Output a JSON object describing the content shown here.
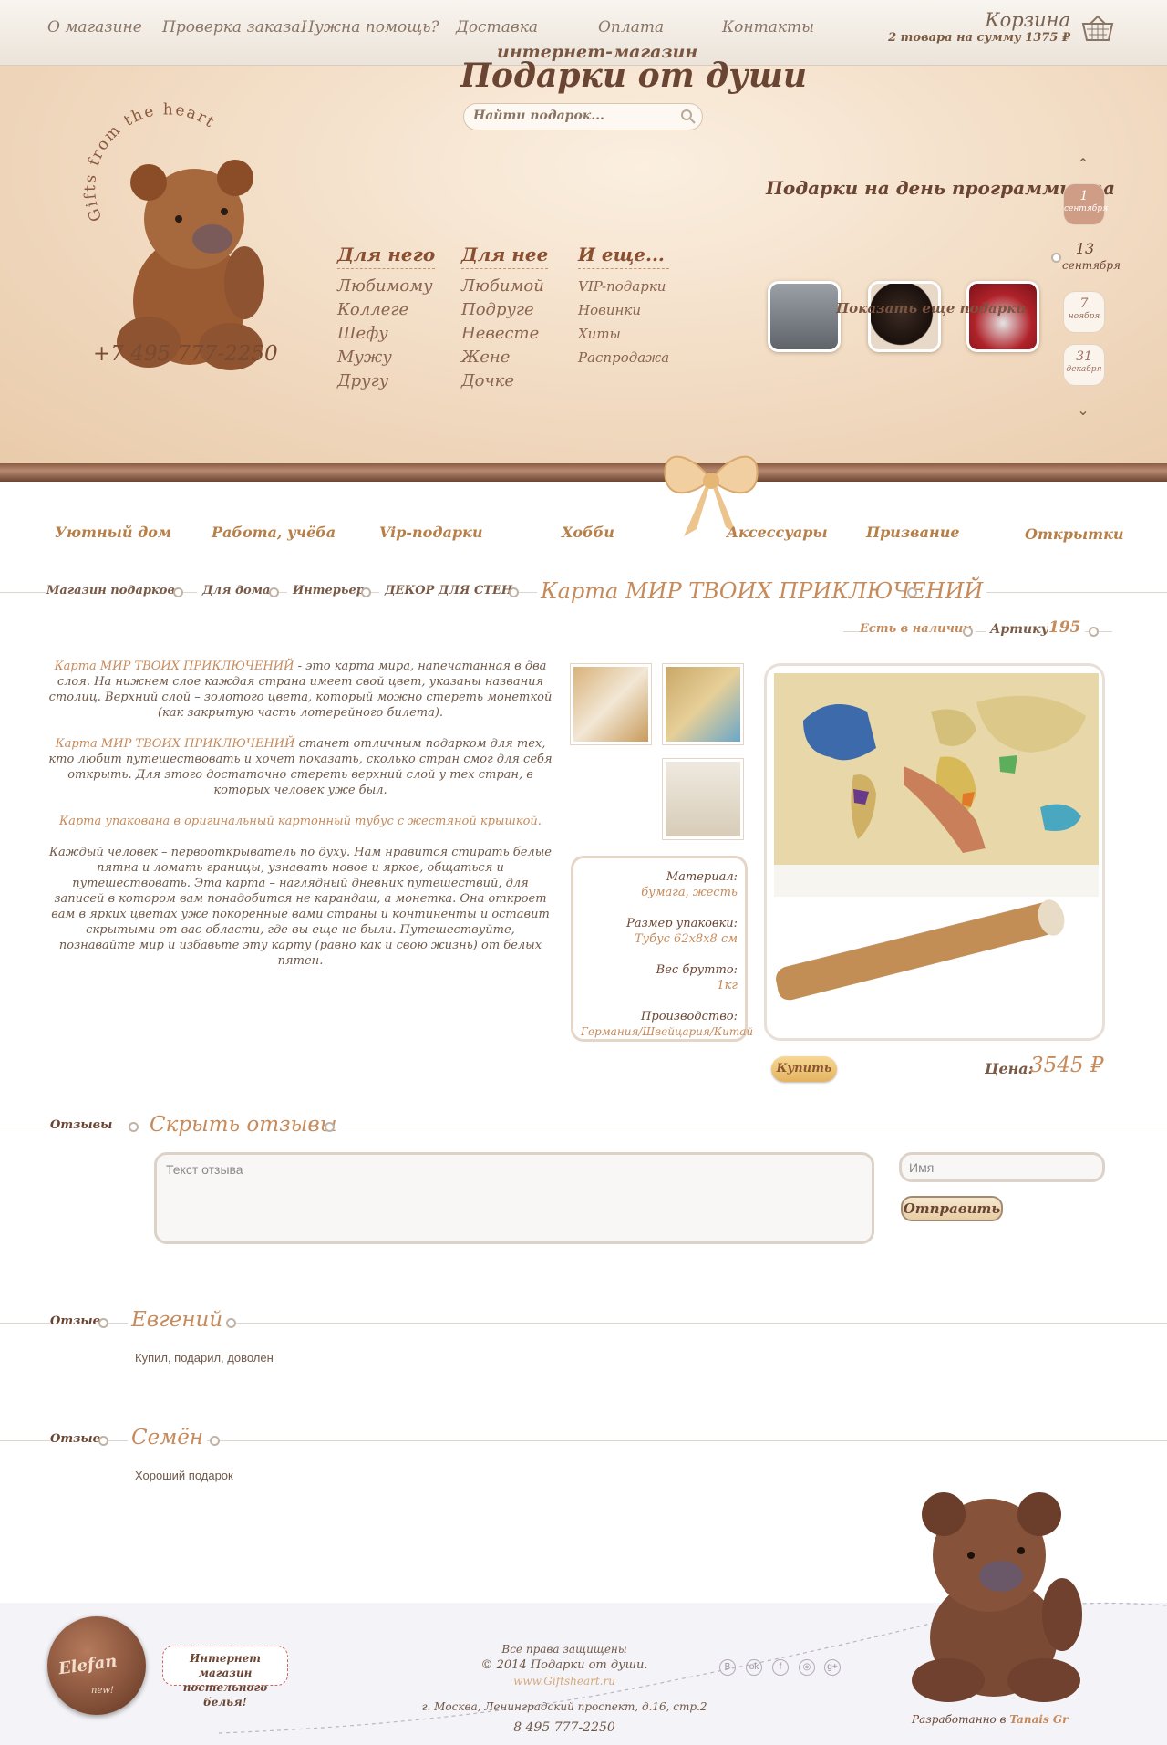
{
  "nav": {
    "items": [
      "О магазине",
      "Проверка заказа",
      "Нужна помощь?",
      "Доставка",
      "Оплата",
      "Контакты"
    ],
    "cart_title": "Корзина",
    "cart_summary": "2 товара на сумму 1375 ₽"
  },
  "header": {
    "slogan": "Gifts from the heart",
    "phone": "+7 495 777-2250",
    "shop_subtitle": "интернет-магазин",
    "shop_title": "Подарки от души",
    "search_placeholder": "Найти подарок...",
    "columns": [
      {
        "title": "Для него",
        "items": [
          "Любимому",
          "Коллеге",
          "Шефу",
          "Мужу",
          "Другу"
        ]
      },
      {
        "title": "Для нее",
        "items": [
          "Любимой",
          "Подруге",
          "Невесте",
          "Жене",
          "Дочке"
        ]
      },
      {
        "title": "И еще...",
        "items": [
          "VIP-подарки",
          "Новинки",
          "Хиты",
          "Распродажа"
        ]
      }
    ],
    "gifts_title": "Подарки на день программиста",
    "more_gifts": "Показать еще подарки",
    "dates": [
      {
        "day": "1",
        "month": "сентября"
      },
      {
        "day": "13",
        "month": "сентября"
      },
      {
        "day": "7",
        "month": "ноября"
      },
      {
        "day": "31",
        "month": "декабря"
      }
    ]
  },
  "categories": [
    "Уютный дом",
    "Работа, учёба",
    "Vip-подарки",
    "Хобби",
    "Аксессуары",
    "Призвание",
    "Открытки"
  ],
  "breadcrumb": [
    "Магазин подарков",
    "Для дома",
    "Интерьер",
    "ДЕКОР ДЛЯ СТЕН"
  ],
  "product": {
    "title": "Карта МИР ТВОИХ ПРИКЛЮЧЕНИЙ",
    "availability": "Есть в наличии",
    "article_label": "Артикул:",
    "article_value": "195",
    "desc1_hl": "Карта МИР ТВОИХ ПРИКЛЮЧЕНИЙ",
    "desc1": " - это карта мира, напечатанная в два слоя. На нижнем слое каждая страна имеет свой цвет, указаны названия столиц. Верхний слой – золотого цвета, который можно стереть монеткой (как закрытую часть лотерейного билета).",
    "desc2_hl": "Карта МИР ТВОИХ ПРИКЛЮЧЕНИЙ",
    "desc2": " станет отличным подарком для тех, кто любит путешествовать и хочет показать, сколько стран смог для себя открыть. Для этого достаточно стереть верхний слой у тех стран, в которых человек уже был.",
    "desc3": "Карта упакована в оригинальный картонный тубус с жестяной крышкой.",
    "desc4": "Каждый человек – первооткрыватель по духу. Нам нравится стирать белые пятна и ломать границы, узнавать новое и яркое, общаться и путешествовать. Эта карта – наглядный дневник путешествий, для записей в котором вам понадобится не карандаш, а монетка. Она откроет вам в ярких цветах уже покоренные вами страны и континенты и оставит скрытыми от вас области, где вы еще не были. Путешествуйте, познавайте мир и избавьте эту карту (равно как и свою жизнь) от белых пятен.",
    "props": [
      {
        "label": "Материал:",
        "value": "бумага, жесть"
      },
      {
        "label": "Размер упаковки:",
        "value": "Тубус 62х8х8 см"
      },
      {
        "label": "Вес брутто:",
        "value": "1кг"
      },
      {
        "label": "Производство:",
        "value": "Германия/Швейцария/Китай"
      }
    ],
    "buy_label": "Купить",
    "price_label": "Цена:",
    "price_value": "3545 ₽"
  },
  "reviews": {
    "section_label": "Отзывы",
    "toggle": "Скрыть отзывы",
    "text_placeholder": "Текст отзыва",
    "name_placeholder": "Имя",
    "send_label": "Отправить",
    "item_label": "Отзыв",
    "items": [
      {
        "author": "Евгений",
        "text": "Купил, подарил, доволен"
      },
      {
        "author": "Семён",
        "text": "Хороший подарок"
      }
    ]
  },
  "footer": {
    "partner_logo": "Elefan",
    "partner_badge": "new!",
    "partner_bubble_1": "Интернет магазин",
    "partner_bubble_2": "постельного белья!",
    "rights": "Все права защищены",
    "copyright": "© 2014 Подарки от души.",
    "site": "www.Giftsheart.ru",
    "address": "г. Москва, Ленинградский проспект, д.16, стр.2",
    "phone": "8 495 777-2250",
    "dev_label": "Разработанно в",
    "dev_name": "Tanais Gr",
    "social_icons": [
      "В",
      "ok",
      "f",
      "◎",
      "g+"
    ]
  },
  "colors": {
    "accent": "#c78a5a",
    "text": "#6b4533",
    "header_bg": "#f2dcc4"
  }
}
